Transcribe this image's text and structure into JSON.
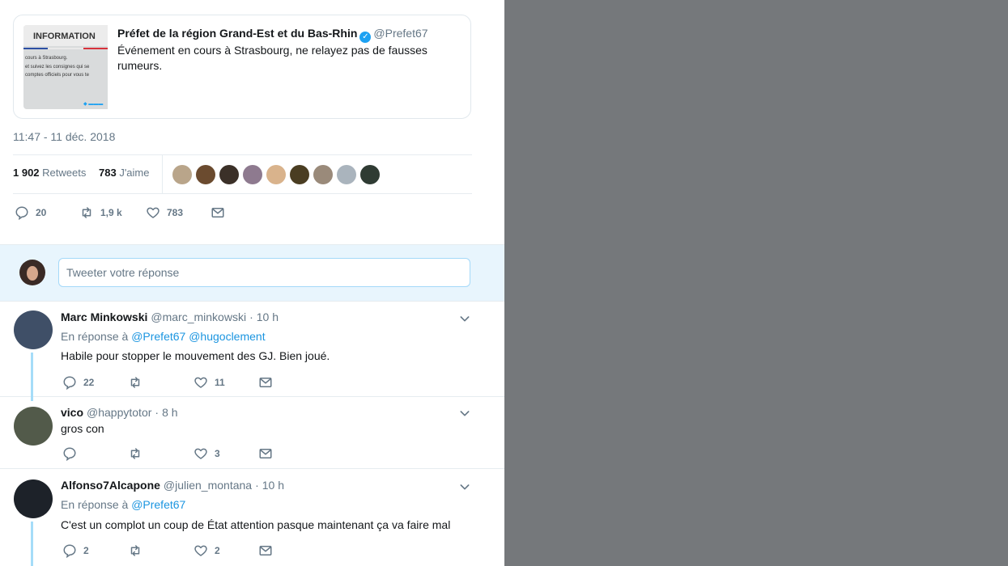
{
  "quoted_tweet": {
    "image_label": "INFORMATION",
    "image_text_lines": [
      "cours à Strasbourg.",
      "et suivez les consignes qui se",
      "comptes officiels pour vous te"
    ],
    "author_name": "Préfet de la région Grand-Est et du Bas-Rhin",
    "author_handle": "@Prefet67",
    "text": "Événement en cours à Strasbourg, ne relayez pas de fausses rumeurs."
  },
  "timestamp": "11:47 - 11 déc. 2018",
  "stats": {
    "retweets_count": "1 902",
    "retweets_label": "Retweets",
    "likes_count": "783",
    "likes_label": "J'aime"
  },
  "likers_colors": [
    "#b9a58a",
    "#6b4b2f",
    "#3b3028",
    "#8e7a8f",
    "#d9b38c",
    "#4a3d22",
    "#9a8a7a",
    "#aab4bd",
    "#2f3b33"
  ],
  "main_actions": {
    "reply_count": "20",
    "retweet_count": "1,9 k",
    "like_count": "783"
  },
  "reply_box": {
    "placeholder": "Tweeter votre réponse"
  },
  "replies": [
    {
      "name": "Marc Minkowski",
      "handle": "@marc_minkowski",
      "time": "10 h",
      "reply_to_label": "En réponse à",
      "mentions": [
        "@Prefet67",
        "@hugoclement"
      ],
      "text": "Habile pour stopper le mouvement des GJ. Bien joué.",
      "reply_count": "22",
      "retweet_count": "",
      "like_count": "11"
    },
    {
      "name": "vico",
      "handle": "@happytotor",
      "time": "8 h",
      "text": "gros con",
      "reply_count": "",
      "retweet_count": "",
      "like_count": "3"
    },
    {
      "name": "Alfonso7Alcapone",
      "handle": "@julien_montana",
      "time": "10 h",
      "reply_to_label": "En réponse à",
      "mentions": [
        "@Prefet67"
      ],
      "text": "C'est un complot un coup de État attention pasque maintenant ça va faire mal",
      "reply_count": "2",
      "retweet_count": "",
      "like_count": "2"
    }
  ],
  "colors": {
    "accent": "#1da1f2",
    "mention": "#1b95e0",
    "muted": "#657786",
    "thread_line": "#a5dcf8",
    "backdrop": "#75787b"
  }
}
